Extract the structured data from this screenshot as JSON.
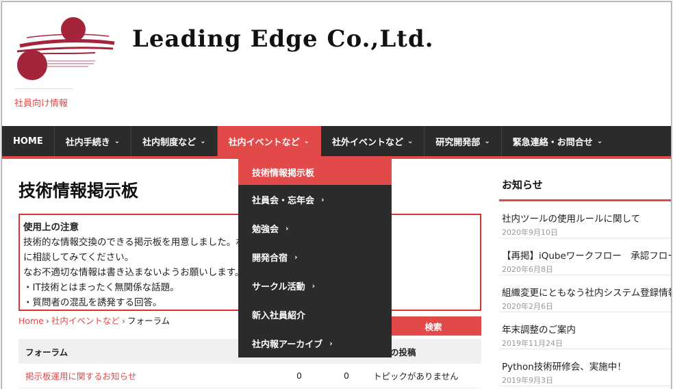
{
  "header": {
    "site_title": "Leading  Edge  Co.,Ltd.",
    "tagline": "社員向け情報"
  },
  "nav": {
    "items": [
      {
        "label": "HOME",
        "has_chevron": false
      },
      {
        "label": "社内手続き",
        "has_chevron": true
      },
      {
        "label": "社内制度など",
        "has_chevron": true
      },
      {
        "label": "社内イベントなど",
        "has_chevron": true,
        "active": true
      },
      {
        "label": "社外イベントなど",
        "has_chevron": true
      },
      {
        "label": "研究開発部",
        "has_chevron": true
      },
      {
        "label": "緊急連絡・お問合せ",
        "has_chevron": true
      }
    ],
    "chevron": "⌄",
    "dropdown": [
      {
        "label": "技術情報掲示板",
        "has_chevron": false,
        "active": true
      },
      {
        "label": "社員会・忘年会",
        "has_chevron": true
      },
      {
        "label": "勉強会",
        "has_chevron": true
      },
      {
        "label": "開発合宿",
        "has_chevron": true
      },
      {
        "label": "サークル活動",
        "has_chevron": true
      },
      {
        "label": "新入社員紹介",
        "has_chevron": false
      },
      {
        "label": "社内報アーカイブ",
        "has_chevron": true
      }
    ],
    "dropdown_chevron": "›"
  },
  "main": {
    "page_title": "技術情報掲示板",
    "notice": {
      "heading": "使用上の注意",
      "line1": "技術的な情報交換のできる掲示板を用意しました。わからないことなどあれば気軽",
      "line2": "に相談してみてください。",
      "line3": "なお不適切な情報は書き込まないようお願いします。",
      "line4": "・IT技術とはまったく無関係な話題。",
      "line5": "・質問者の混乱を誘発する回答。"
    },
    "breadcrumb": {
      "home": "Home",
      "sep": "›",
      "category": "社内イベントなど",
      "current": "フォーラム"
    },
    "search_label": "検索",
    "forum_table": {
      "headers": {
        "forum": "フォーラム",
        "topics": "",
        "posts": "",
        "latest": "最新の投稿"
      },
      "rows": [
        {
          "forum": "掲示板運用に関するお知らせ",
          "topics": "0",
          "posts": "0",
          "latest": "トピックがありません"
        }
      ]
    }
  },
  "sidebar": {
    "title": "お知らせ",
    "news": [
      {
        "title": "社内ツールの使用ルールに関して",
        "date": "2020年9月10日"
      },
      {
        "title": "【再掲】iQubeワークフロー　承認フロー",
        "date": "2020年6月8日"
      },
      {
        "title": "組織変更にともなう社内システム登録情報",
        "date": "2020年2月6日"
      },
      {
        "title": "年末調整のご案内",
        "date": "2019年11月24日"
      },
      {
        "title": "Python技術研修会、実施中！",
        "date": "2019年9月3日"
      }
    ]
  },
  "colors": {
    "accent": "#e24a4a",
    "nav_bg": "#2b2b2b",
    "logo": "#a3243b"
  }
}
